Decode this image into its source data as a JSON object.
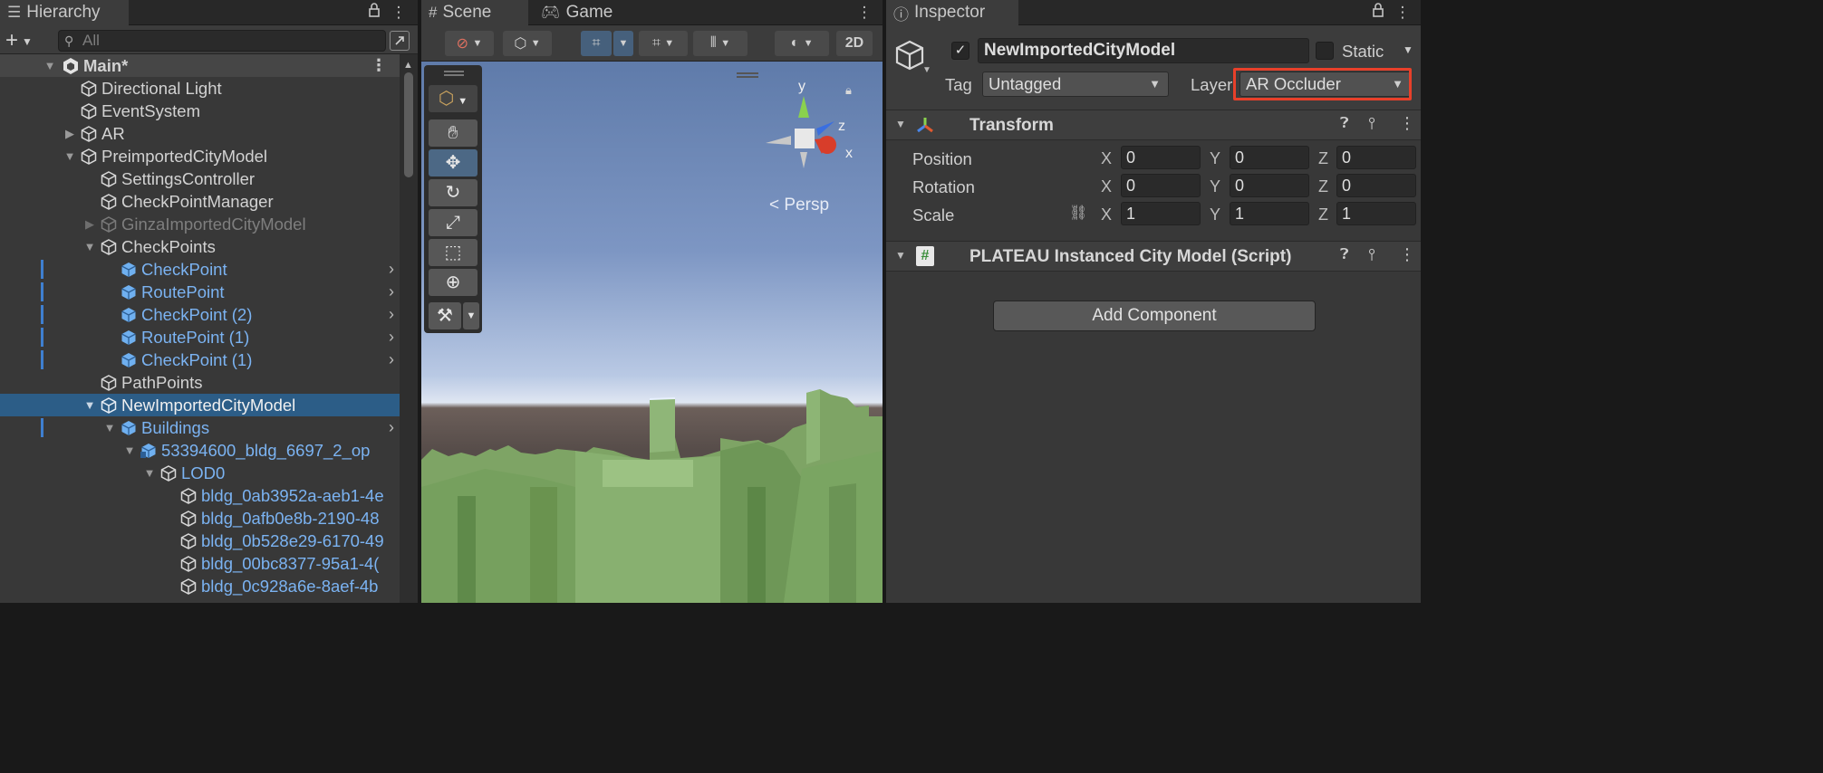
{
  "hierarchy": {
    "tab_label": "Hierarchy",
    "search_placeholder": "All",
    "rows": [
      {
        "label": "Main*",
        "kind": "scene"
      },
      {
        "label": "Directional Light"
      },
      {
        "label": "EventSystem"
      },
      {
        "label": "AR"
      },
      {
        "label": "PreimportedCityModel"
      },
      {
        "label": "SettingsController"
      },
      {
        "label": "CheckPointManager"
      },
      {
        "label": "GinzaImportedCityModel"
      },
      {
        "label": "CheckPoints"
      },
      {
        "label": "CheckPoint"
      },
      {
        "label": "RoutePoint"
      },
      {
        "label": "CheckPoint (2)"
      },
      {
        "label": "RoutePoint (1)"
      },
      {
        "label": "CheckPoint (1)"
      },
      {
        "label": "PathPoints"
      },
      {
        "label": "NewImportedCityModel"
      },
      {
        "label": "Buildings"
      },
      {
        "label": "53394600_bldg_6697_2_op"
      },
      {
        "label": "LOD0"
      },
      {
        "label": "bldg_0ab3952a-aeb1-4e"
      },
      {
        "label": "bldg_0afb0e8b-2190-48"
      },
      {
        "label": "bldg_0b528e29-6170-49"
      },
      {
        "label": "bldg_00bc8377-95a1-4("
      },
      {
        "label": "bldg_0c928a6e-8aef-4b"
      }
    ]
  },
  "scene": {
    "tab_scene": "Scene",
    "tab_game": "Game",
    "toggle_2d": "2D",
    "persp_label": "Persp",
    "gizmo": {
      "y": "y",
      "x": "x",
      "z": "z"
    }
  },
  "inspector": {
    "tab_label": "Inspector",
    "object_name": "NewImportedCityModel",
    "static_label": "Static",
    "tag_label": "Tag",
    "tag_value": "Untagged",
    "layer_label": "Layer",
    "layer_value": "AR Occluder",
    "transform": {
      "title": "Transform",
      "position_label": "Position",
      "rotation_label": "Rotation",
      "scale_label": "Scale",
      "axis_x": "X",
      "axis_y": "Y",
      "axis_z": "Z",
      "position": [
        "0",
        "0",
        "0"
      ],
      "rotation": [
        "0",
        "0",
        "0"
      ],
      "scale": [
        "1",
        "1",
        "1"
      ]
    },
    "script_component": {
      "title": "PLATEAU Instanced City Model (Script)",
      "icon": "#"
    },
    "add_component_label": "Add Component"
  },
  "colors": {
    "selection": "#2c5d87",
    "prefab_blue": "#7bb3f2",
    "highlight_red": "#e8402a",
    "buildings_green": "#7fa666"
  }
}
